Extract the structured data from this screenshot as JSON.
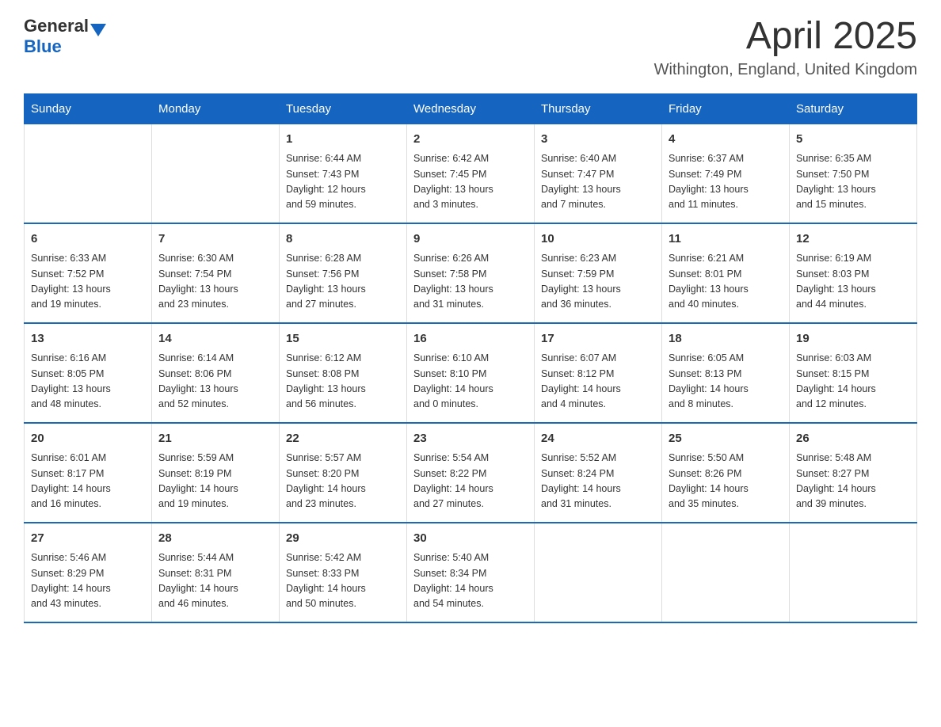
{
  "header": {
    "logo_general": "General",
    "logo_blue": "Blue",
    "month_title": "April 2025",
    "location": "Withington, England, United Kingdom"
  },
  "days_of_week": [
    "Sunday",
    "Monday",
    "Tuesday",
    "Wednesday",
    "Thursday",
    "Friday",
    "Saturday"
  ],
  "weeks": [
    [
      {
        "day": "",
        "info": ""
      },
      {
        "day": "",
        "info": ""
      },
      {
        "day": "1",
        "info": "Sunrise: 6:44 AM\nSunset: 7:43 PM\nDaylight: 12 hours\nand 59 minutes."
      },
      {
        "day": "2",
        "info": "Sunrise: 6:42 AM\nSunset: 7:45 PM\nDaylight: 13 hours\nand 3 minutes."
      },
      {
        "day": "3",
        "info": "Sunrise: 6:40 AM\nSunset: 7:47 PM\nDaylight: 13 hours\nand 7 minutes."
      },
      {
        "day": "4",
        "info": "Sunrise: 6:37 AM\nSunset: 7:49 PM\nDaylight: 13 hours\nand 11 minutes."
      },
      {
        "day": "5",
        "info": "Sunrise: 6:35 AM\nSunset: 7:50 PM\nDaylight: 13 hours\nand 15 minutes."
      }
    ],
    [
      {
        "day": "6",
        "info": "Sunrise: 6:33 AM\nSunset: 7:52 PM\nDaylight: 13 hours\nand 19 minutes."
      },
      {
        "day": "7",
        "info": "Sunrise: 6:30 AM\nSunset: 7:54 PM\nDaylight: 13 hours\nand 23 minutes."
      },
      {
        "day": "8",
        "info": "Sunrise: 6:28 AM\nSunset: 7:56 PM\nDaylight: 13 hours\nand 27 minutes."
      },
      {
        "day": "9",
        "info": "Sunrise: 6:26 AM\nSunset: 7:58 PM\nDaylight: 13 hours\nand 31 minutes."
      },
      {
        "day": "10",
        "info": "Sunrise: 6:23 AM\nSunset: 7:59 PM\nDaylight: 13 hours\nand 36 minutes."
      },
      {
        "day": "11",
        "info": "Sunrise: 6:21 AM\nSunset: 8:01 PM\nDaylight: 13 hours\nand 40 minutes."
      },
      {
        "day": "12",
        "info": "Sunrise: 6:19 AM\nSunset: 8:03 PM\nDaylight: 13 hours\nand 44 minutes."
      }
    ],
    [
      {
        "day": "13",
        "info": "Sunrise: 6:16 AM\nSunset: 8:05 PM\nDaylight: 13 hours\nand 48 minutes."
      },
      {
        "day": "14",
        "info": "Sunrise: 6:14 AM\nSunset: 8:06 PM\nDaylight: 13 hours\nand 52 minutes."
      },
      {
        "day": "15",
        "info": "Sunrise: 6:12 AM\nSunset: 8:08 PM\nDaylight: 13 hours\nand 56 minutes."
      },
      {
        "day": "16",
        "info": "Sunrise: 6:10 AM\nSunset: 8:10 PM\nDaylight: 14 hours\nand 0 minutes."
      },
      {
        "day": "17",
        "info": "Sunrise: 6:07 AM\nSunset: 8:12 PM\nDaylight: 14 hours\nand 4 minutes."
      },
      {
        "day": "18",
        "info": "Sunrise: 6:05 AM\nSunset: 8:13 PM\nDaylight: 14 hours\nand 8 minutes."
      },
      {
        "day": "19",
        "info": "Sunrise: 6:03 AM\nSunset: 8:15 PM\nDaylight: 14 hours\nand 12 minutes."
      }
    ],
    [
      {
        "day": "20",
        "info": "Sunrise: 6:01 AM\nSunset: 8:17 PM\nDaylight: 14 hours\nand 16 minutes."
      },
      {
        "day": "21",
        "info": "Sunrise: 5:59 AM\nSunset: 8:19 PM\nDaylight: 14 hours\nand 19 minutes."
      },
      {
        "day": "22",
        "info": "Sunrise: 5:57 AM\nSunset: 8:20 PM\nDaylight: 14 hours\nand 23 minutes."
      },
      {
        "day": "23",
        "info": "Sunrise: 5:54 AM\nSunset: 8:22 PM\nDaylight: 14 hours\nand 27 minutes."
      },
      {
        "day": "24",
        "info": "Sunrise: 5:52 AM\nSunset: 8:24 PM\nDaylight: 14 hours\nand 31 minutes."
      },
      {
        "day": "25",
        "info": "Sunrise: 5:50 AM\nSunset: 8:26 PM\nDaylight: 14 hours\nand 35 minutes."
      },
      {
        "day": "26",
        "info": "Sunrise: 5:48 AM\nSunset: 8:27 PM\nDaylight: 14 hours\nand 39 minutes."
      }
    ],
    [
      {
        "day": "27",
        "info": "Sunrise: 5:46 AM\nSunset: 8:29 PM\nDaylight: 14 hours\nand 43 minutes."
      },
      {
        "day": "28",
        "info": "Sunrise: 5:44 AM\nSunset: 8:31 PM\nDaylight: 14 hours\nand 46 minutes."
      },
      {
        "day": "29",
        "info": "Sunrise: 5:42 AM\nSunset: 8:33 PM\nDaylight: 14 hours\nand 50 minutes."
      },
      {
        "day": "30",
        "info": "Sunrise: 5:40 AM\nSunset: 8:34 PM\nDaylight: 14 hours\nand 54 minutes."
      },
      {
        "day": "",
        "info": ""
      },
      {
        "day": "",
        "info": ""
      },
      {
        "day": "",
        "info": ""
      }
    ]
  ]
}
